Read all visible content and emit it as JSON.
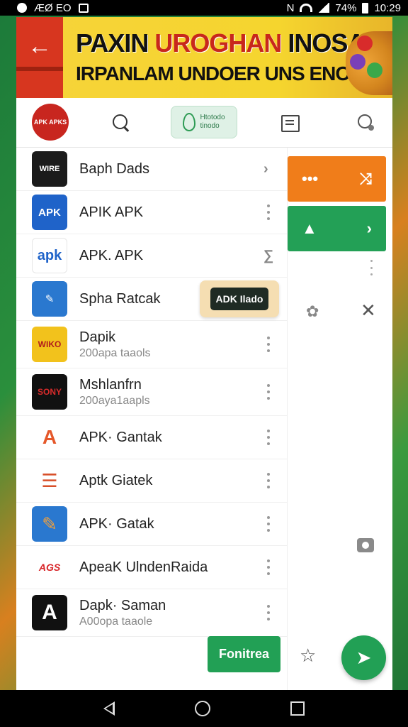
{
  "statusbar": {
    "left_text": "ÆØ EO",
    "battery_text": "74%",
    "time": "10:29"
  },
  "banner": {
    "back_icon": "arrow-left-icon",
    "title_part1": "PAXIN",
    "title_part2": "UROGHAN",
    "title_part3": "INOSAA",
    "subtitle": "IRPANLAM UNDOER UNS ENOGA!"
  },
  "toolbar": {
    "logo_text": "APK APKS",
    "brand_text_line1": "Htotodo",
    "brand_text_line2": "tinodo"
  },
  "rows": [
    {
      "title": "Baph Dads",
      "sub": "",
      "icon_text": "WIRE",
      "icon_bg": "#1b1b1b",
      "accessory": "chevron"
    },
    {
      "title": "APIK APK",
      "sub": "",
      "icon_text": "APK",
      "icon_bg": "#1f63c9",
      "accessory": "kebab"
    },
    {
      "title": "APK. APK",
      "sub": "",
      "icon_text": "apk",
      "icon_bg": "#ffffff",
      "accessory": "chevron"
    },
    {
      "title": "Spha Ratcak",
      "sub": "",
      "icon_text": "",
      "icon_bg": "#2a78cf",
      "accessory": "badge"
    },
    {
      "title": "Dapik",
      "sub": "200apa taaols",
      "icon_text": "WIKO",
      "icon_bg": "#f2c21c",
      "accessory": "kebab"
    },
    {
      "title": "Mshlanfrn",
      "sub": "200aya1aapls",
      "icon_text": "SONY",
      "icon_bg": "#111111",
      "accessory": "kebab"
    },
    {
      "title": "APK· Gantak",
      "sub": "",
      "icon_text": "A",
      "icon_bg": "#ffffff",
      "accessory": "kebab"
    },
    {
      "title": "Aptk Giatek",
      "sub": "",
      "icon_text": "",
      "icon_bg": "#ffffff",
      "accessory": "kebab"
    },
    {
      "title": "APK· Gatak",
      "sub": "",
      "icon_text": "",
      "icon_bg": "#2a78cf",
      "accessory": "kebab"
    },
    {
      "title": "ApeaK UlndenRaida",
      "sub": "",
      "icon_text": "AGS",
      "icon_bg": "#ffffff",
      "accessory": "kebab"
    },
    {
      "title": "Dapk· Saman",
      "sub": "A00opa taaole",
      "icon_text": "A",
      "icon_bg": "#111111",
      "accessory": "kebab"
    }
  ],
  "badge": {
    "label": "ADK Ilado"
  },
  "side": {
    "orange_left": "•••",
    "orange_right": "⤨",
    "green_right": "›"
  },
  "bottom": {
    "action_label": "Fonitrea"
  },
  "colors": {
    "accent_green": "#22a055",
    "accent_orange": "#f07d1a",
    "banner_yellow": "#f6d33a",
    "back_red": "#d7361f"
  }
}
